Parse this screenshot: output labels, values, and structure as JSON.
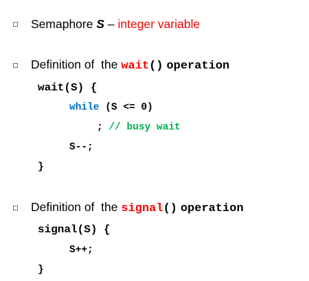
{
  "bullets": [
    {
      "icon": "square-bullet-icon",
      "color": "#c0504d",
      "word": "Semaphore",
      "symbol": "S",
      "dash": "–",
      "description": "integer variable"
    },
    {
      "icon": "square-bullet-icon",
      "prefix": "Definition of  the",
      "keyword": "wait",
      "parens": "()",
      "suffix": "operation"
    },
    {
      "icon": "square-bullet-icon",
      "prefix": "Definition of  the",
      "keyword": "signal",
      "parens": "()",
      "suffix": "operation"
    }
  ],
  "wait_code": {
    "signature": "wait(S) {",
    "while_keyword": "while",
    "while_condition": "(S <= 0)",
    "semicolon": ";",
    "comment": "// busy wait",
    "decrement": "S--;",
    "close": "}"
  },
  "signal_code": {
    "signature": "signal(S) {",
    "increment": "S++;",
    "close": "}"
  },
  "colors": {
    "text": "#000000",
    "red": "#ff0000",
    "keyword_blue": "#0070c0",
    "comment_green": "#00b050",
    "bullet": "#c0504d"
  }
}
